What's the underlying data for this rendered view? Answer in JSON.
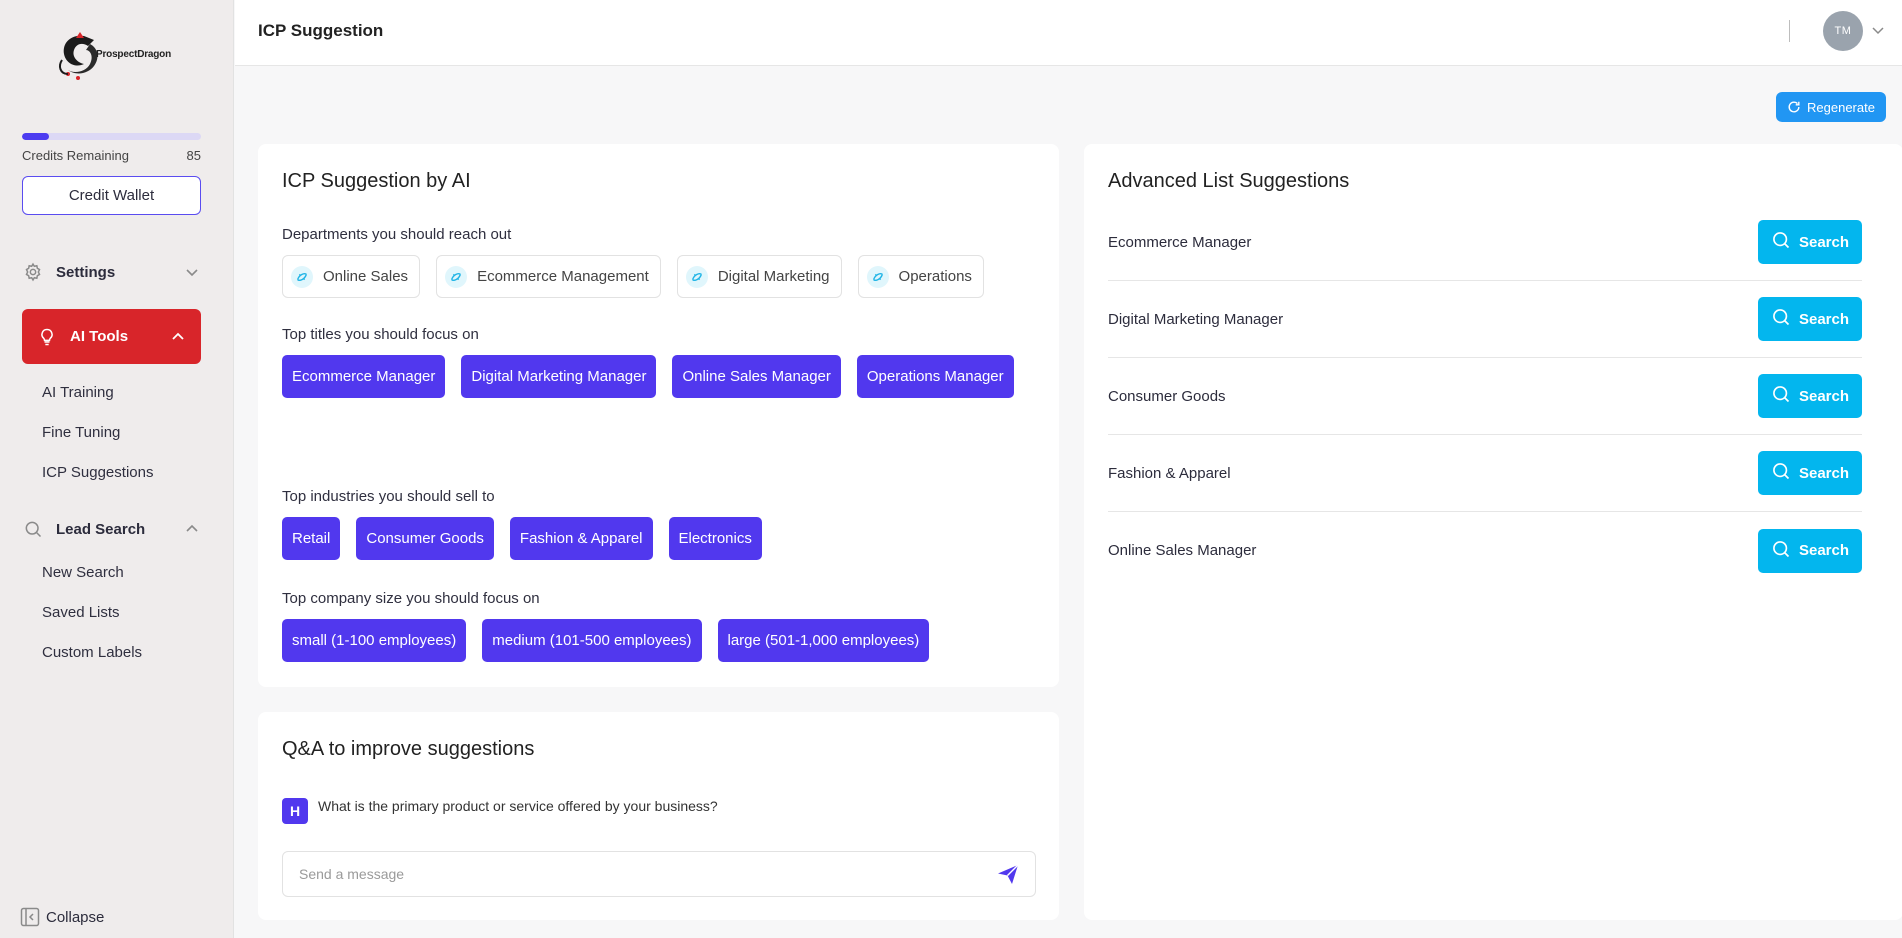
{
  "brand": {
    "name": "ProspectDragon"
  },
  "sidebar": {
    "credits_label": "Credits Remaining",
    "credits_value": "85",
    "credits_fraction": 0.15,
    "credit_wallet": "Credit Wallet",
    "settings_label": "Settings",
    "ai_tools_label": "AI Tools",
    "ai_tools_items": [
      "AI Training",
      "Fine Tuning",
      "ICP Suggestions"
    ],
    "lead_search_label": "Lead Search",
    "lead_search_items": [
      "New Search",
      "Saved Lists",
      "Custom Labels"
    ],
    "collapse_label": "Collapse"
  },
  "header": {
    "title": "ICP Suggestion",
    "avatar_initials": "TM"
  },
  "toolbar": {
    "regenerate_label": "Regenerate"
  },
  "icp": {
    "title": "ICP Suggestion by AI",
    "departments_label": "Departments you should reach out",
    "departments": [
      "Online Sales",
      "Ecommerce Management",
      "Digital Marketing",
      "Operations"
    ],
    "titles_label": "Top titles you should focus on",
    "titles": [
      "Ecommerce Manager",
      "Digital Marketing Manager",
      "Online Sales Manager",
      "Operations Manager"
    ],
    "industries_label": "Top industries you should sell to",
    "industries": [
      "Retail",
      "Consumer Goods",
      "Fashion & Apparel",
      "Electronics"
    ],
    "company_size_label": "Top company size you should focus on",
    "company_sizes": [
      "small (1-100 employees)",
      "medium (101-500 employees)",
      "large (501-1,000 employees)"
    ]
  },
  "qa": {
    "title": "Q&A to improve suggestions",
    "badge": "H",
    "question": "What is the primary product or service offered by your business?",
    "input_placeholder": "Send a message",
    "input_value": ""
  },
  "advanced": {
    "title": "Advanced List Suggestions",
    "search_label": "Search",
    "items": [
      "Ecommerce Manager",
      "Digital Marketing Manager",
      "Consumer Goods",
      "Fashion & Apparel",
      "Online Sales Manager"
    ]
  },
  "colors": {
    "primary": "#5138ee",
    "danger": "#d8252a",
    "search": "#03b6ee",
    "regenerate": "#2196f3"
  }
}
